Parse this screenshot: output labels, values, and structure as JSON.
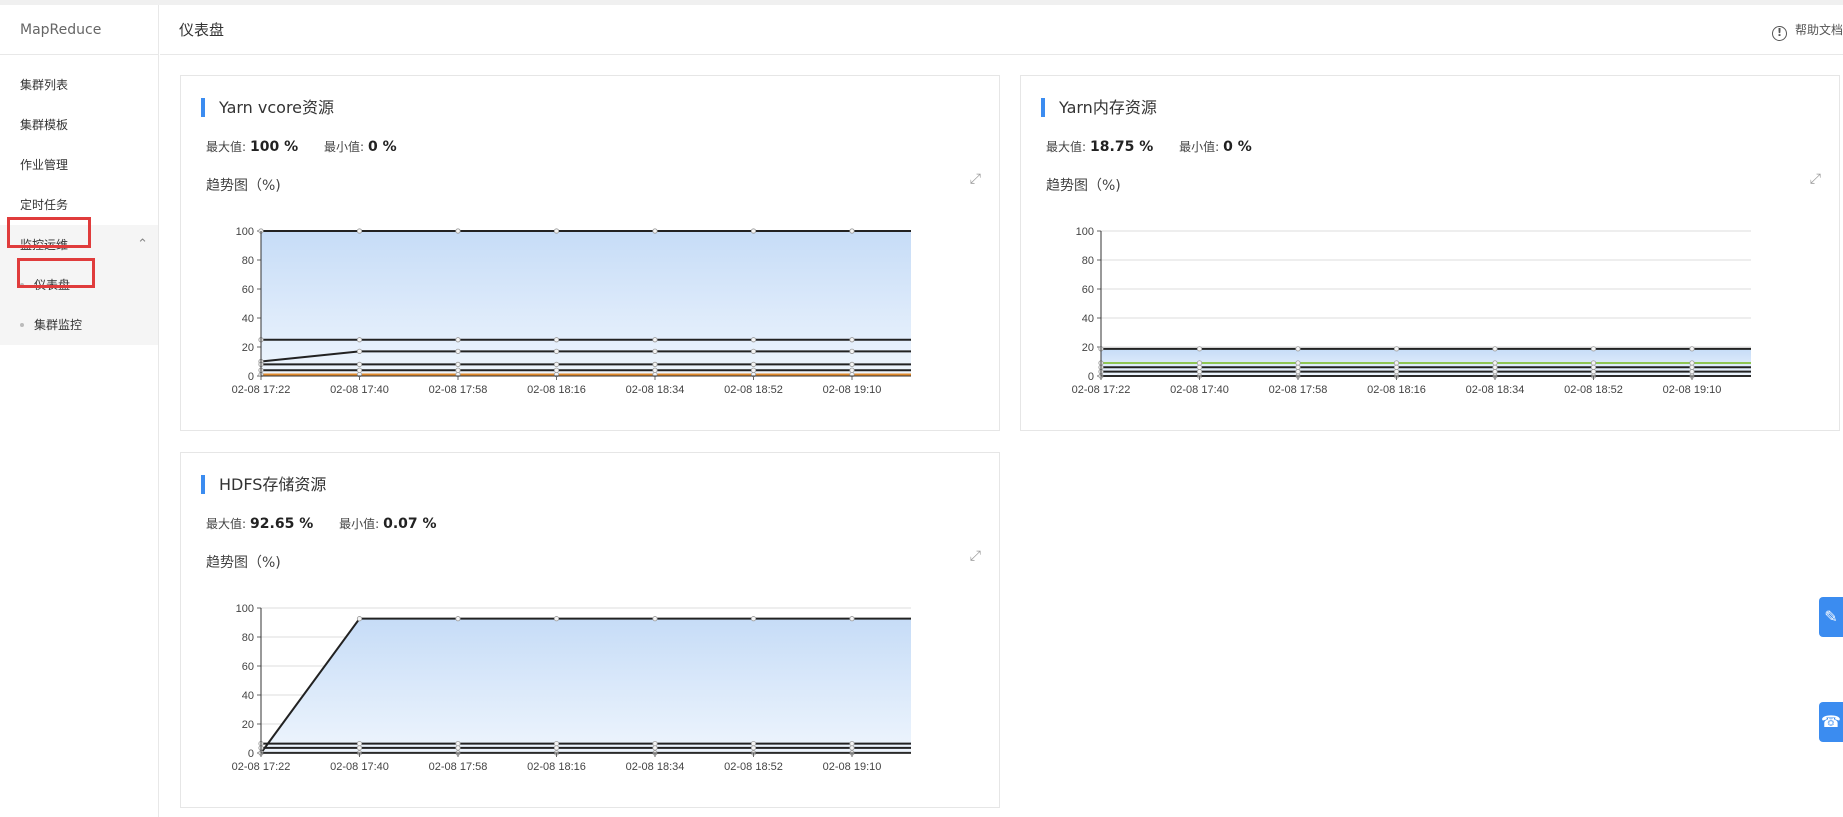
{
  "sidebar": {
    "title": "MapReduce",
    "items": [
      {
        "label": "集群列表"
      },
      {
        "label": "集群模板"
      },
      {
        "label": "作业管理"
      },
      {
        "label": "定时任务"
      }
    ],
    "group": {
      "label": "监控运维",
      "children": [
        {
          "label": "仪表盘"
        },
        {
          "label": "集群监控"
        }
      ]
    }
  },
  "header": {
    "title": "仪表盘",
    "help_label": "帮助文档"
  },
  "labels": {
    "max": "最大值:",
    "min": "最小值:",
    "trend": "趋势图（%)"
  },
  "cards": [
    {
      "title": "Yarn vcore资源",
      "max": "100 %",
      "min": "0 %"
    },
    {
      "title": "Yarn内存资源",
      "max": "18.75 %",
      "min": "0 %"
    },
    {
      "title": "HDFS存储资源",
      "max": "92.65 %",
      "min": "0.07 %"
    }
  ],
  "chart_data": [
    {
      "type": "area",
      "title": "",
      "x": [
        "02-08 17:22",
        "02-08 17:40",
        "02-08 17:58",
        "02-08 18:16",
        "02-08 18:34",
        "02-08 18:52",
        "02-08 19:10"
      ],
      "ylim": [
        0,
        100
      ],
      "yticks": [
        0,
        20,
        40,
        60,
        80,
        100
      ],
      "grid": true,
      "series": [
        {
          "values": [
            100,
            100,
            100,
            100,
            100,
            100,
            100,
            100
          ],
          "color": "#222222",
          "fill": true
        },
        {
          "values": [
            25,
            25,
            25,
            25,
            25,
            25,
            25,
            25
          ],
          "color": "#222222"
        },
        {
          "values": [
            10,
            17,
            17,
            17,
            17,
            17,
            17,
            17
          ],
          "color": "#222222"
        },
        {
          "values": [
            8,
            8,
            8,
            8,
            8,
            8,
            8,
            8
          ],
          "color": "#222222"
        },
        {
          "values": [
            4,
            4,
            4,
            4,
            4,
            4,
            4,
            4
          ],
          "color": "#222222"
        },
        {
          "values": [
            1,
            1,
            1,
            1,
            1,
            1,
            1,
            1
          ],
          "color": "#e08a2c"
        }
      ]
    },
    {
      "type": "area",
      "title": "",
      "x": [
        "02-08 17:22",
        "02-08 17:40",
        "02-08 17:58",
        "02-08 18:16",
        "02-08 18:34",
        "02-08 18:52",
        "02-08 19:10"
      ],
      "ylim": [
        0,
        100
      ],
      "yticks": [
        0,
        20,
        40,
        60,
        80,
        100
      ],
      "grid": true,
      "series": [
        {
          "values": [
            18.75,
            18.75,
            18.75,
            18.75,
            18.75,
            18.75,
            18.75,
            18.75
          ],
          "color": "#222222",
          "fill": true
        },
        {
          "values": [
            9,
            9,
            9,
            9,
            9,
            9,
            9,
            9
          ],
          "color": "#8fc653"
        },
        {
          "values": [
            6,
            6,
            6,
            6,
            6,
            6,
            6,
            6
          ],
          "color": "#222222"
        },
        {
          "values": [
            3,
            3,
            3,
            3,
            3,
            3,
            3,
            3
          ],
          "color": "#222222"
        },
        {
          "values": [
            0,
            0,
            0,
            0,
            0,
            0,
            0,
            0
          ],
          "color": "#222222"
        }
      ]
    },
    {
      "type": "area",
      "title": "",
      "x": [
        "02-08 17:22",
        "02-08 17:40",
        "02-08 17:58",
        "02-08 18:16",
        "02-08 18:34",
        "02-08 18:52",
        "02-08 19:10"
      ],
      "ylim": [
        0,
        100
      ],
      "yticks": [
        0,
        20,
        40,
        60,
        80,
        100
      ],
      "grid": true,
      "series": [
        {
          "values": [
            0,
            92.65,
            92.65,
            92.65,
            92.65,
            92.65,
            92.65,
            92.65
          ],
          "color": "#222222",
          "fill": true
        },
        {
          "values": [
            6.5,
            6.5,
            6.5,
            6.5,
            6.5,
            6.5,
            6.5,
            6.5
          ],
          "color": "#222222"
        },
        {
          "values": [
            3.5,
            3.5,
            3.5,
            3.5,
            3.5,
            3.5,
            3.5,
            3.5
          ],
          "color": "#222222"
        },
        {
          "values": [
            0.07,
            0.07,
            0.07,
            0.07,
            0.07,
            0.07,
            0.07,
            0.07
          ],
          "color": "#222222"
        }
      ]
    }
  ]
}
